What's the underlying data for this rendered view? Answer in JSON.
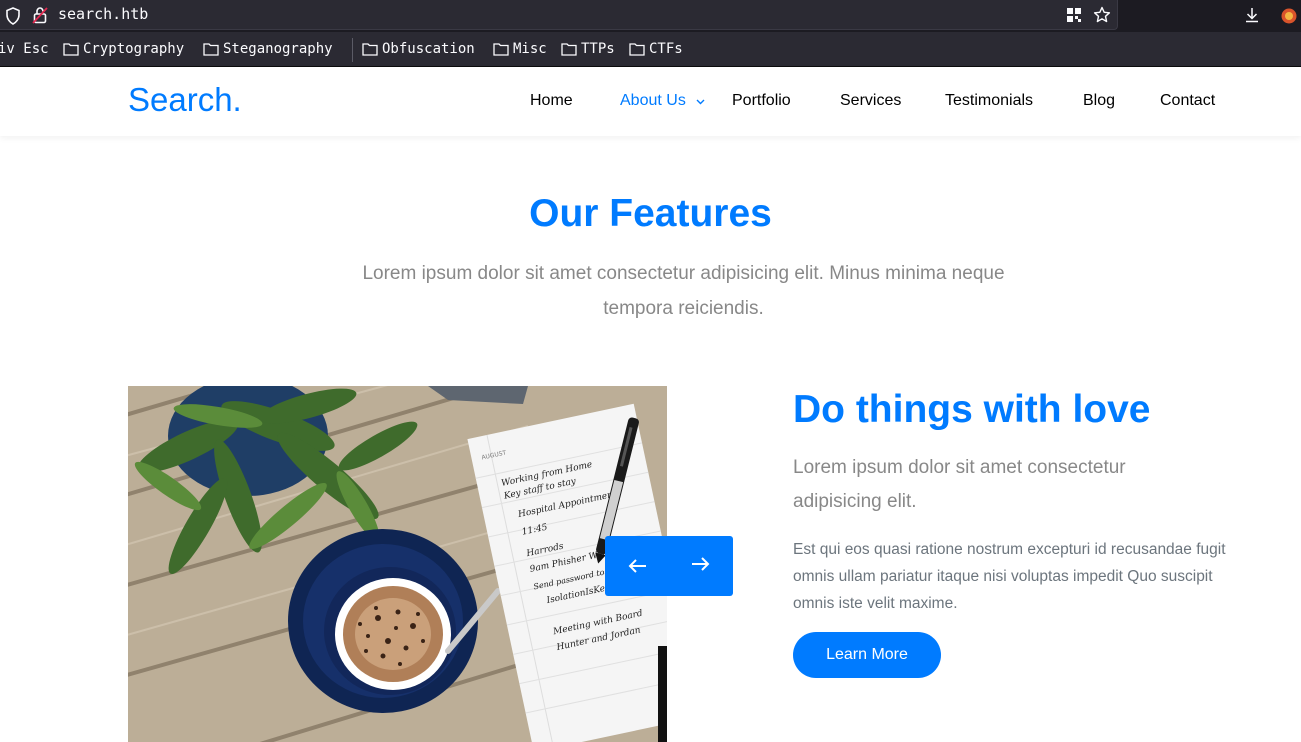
{
  "browser": {
    "url": "search.htb",
    "bookmarks": [
      {
        "label": "iv Esc",
        "folder": false
      },
      {
        "label": "Cryptography",
        "folder": true
      },
      {
        "label": "Steganography",
        "folder": true
      },
      {
        "label": "Obfuscation",
        "folder": true
      },
      {
        "label": "Misc",
        "folder": true
      },
      {
        "label": "TTPs",
        "folder": true
      },
      {
        "label": "CTFs",
        "folder": true
      }
    ]
  },
  "site": {
    "logo": "Search.",
    "nav": [
      {
        "label": "Home",
        "active": false
      },
      {
        "label": "About Us",
        "active": true,
        "dropdown": true
      },
      {
        "label": "Portfolio",
        "active": false
      },
      {
        "label": "Services",
        "active": false
      },
      {
        "label": "Testimonials",
        "active": false
      },
      {
        "label": "Blog",
        "active": false
      },
      {
        "label": "Contact",
        "active": false
      }
    ]
  },
  "features": {
    "title": "Our Features",
    "subtitle": "Lorem ipsum dolor sit amet consectetur adipisicing elit. Minus minima neque tempora reiciendis."
  },
  "feature_item": {
    "heading": "Do things with love",
    "lead": "Lorem ipsum dolor sit amet consectetur adipisicing elit.",
    "body": "Est qui eos quasi ratione nostrum excepturi id recusandae fugit omnis ullam pariatur itaque nisi voluptas impedit Quo suscipit omnis iste velit maxime.",
    "button_label": "Learn More"
  },
  "notebook": {
    "month": "AUGUST",
    "entries": [
      "Working from Home",
      "Key staff to stay",
      "Hospital Appointment",
      "11:45",
      "Harrods",
      "9am Phisher Walter",
      "Send password to Hope Sharp",
      "IsolationIsKey?",
      "Meeting with Board",
      "Hunter and Jordan"
    ]
  },
  "colors": {
    "accent": "#007bff",
    "chrome_bg": "#1c1b22",
    "toolbar_bg": "#2b2a33"
  }
}
